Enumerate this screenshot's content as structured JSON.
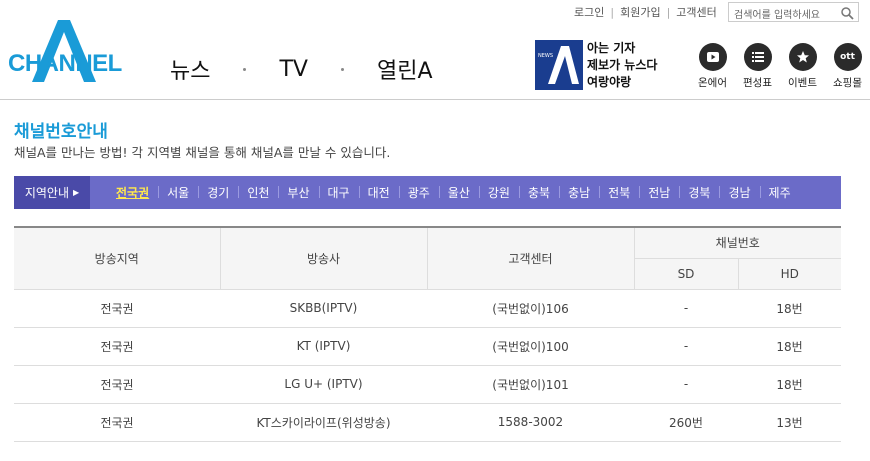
{
  "util": {
    "links": [
      "로그인",
      "회원가입",
      "고객센터"
    ],
    "search_placeholder": "검색어를 입력하세요"
  },
  "logo": {
    "text": "CHANNEL",
    "mark": "A"
  },
  "nav": {
    "items": [
      "뉴스",
      "TV",
      "열린A"
    ]
  },
  "promo": {
    "badge": "NEWS",
    "lines": [
      "아는 기자",
      "제보가 뉴스다",
      "여랑야랑"
    ]
  },
  "quick": [
    {
      "label": "온에어",
      "icon": "play-icon"
    },
    {
      "label": "편성표",
      "icon": "list-icon"
    },
    {
      "label": "이벤트",
      "icon": "star-icon"
    },
    {
      "label": "쇼핑몰",
      "icon": "ott-icon",
      "icon_text": "ott"
    }
  ],
  "page": {
    "title": "채널번호안내",
    "desc": "채널A를 만나는 방법! 각 지역별 채널을 통해 채널A를 만날 수 있습니다."
  },
  "region": {
    "head_label": "지역안내",
    "active": "전국권",
    "tabs": [
      "전국권",
      "서울",
      "경기",
      "인천",
      "부산",
      "대구",
      "대전",
      "광주",
      "울산",
      "강원",
      "충북",
      "충남",
      "전북",
      "전남",
      "경북",
      "경남",
      "제주"
    ]
  },
  "table": {
    "headers": {
      "region": "방송지역",
      "broadcaster": "방송사",
      "cs": "고객센터",
      "channel": "채널번호",
      "sd": "SD",
      "hd": "HD"
    },
    "rows": [
      {
        "region": "전국권",
        "broadcaster": "SKBB(IPTV)",
        "cs": "(국번없이)106",
        "sd": "-",
        "hd": "18번"
      },
      {
        "region": "전국권",
        "broadcaster": "KT (IPTV)",
        "cs": "(국번없이)100",
        "sd": "-",
        "hd": "18번"
      },
      {
        "region": "전국권",
        "broadcaster": "LG U+ (IPTV)",
        "cs": "(국번없이)101",
        "sd": "-",
        "hd": "18번"
      },
      {
        "region": "전국권",
        "broadcaster": "KT스카이라이프(위성방송)",
        "cs": "1588-3002",
        "sd": "260번",
        "hd": "13번"
      }
    ]
  },
  "colors": {
    "brand": "#1a9bd7",
    "nav_bar": "#6b6bc8",
    "nav_head": "#4a4aa8",
    "active_tab": "#ffe84d"
  }
}
